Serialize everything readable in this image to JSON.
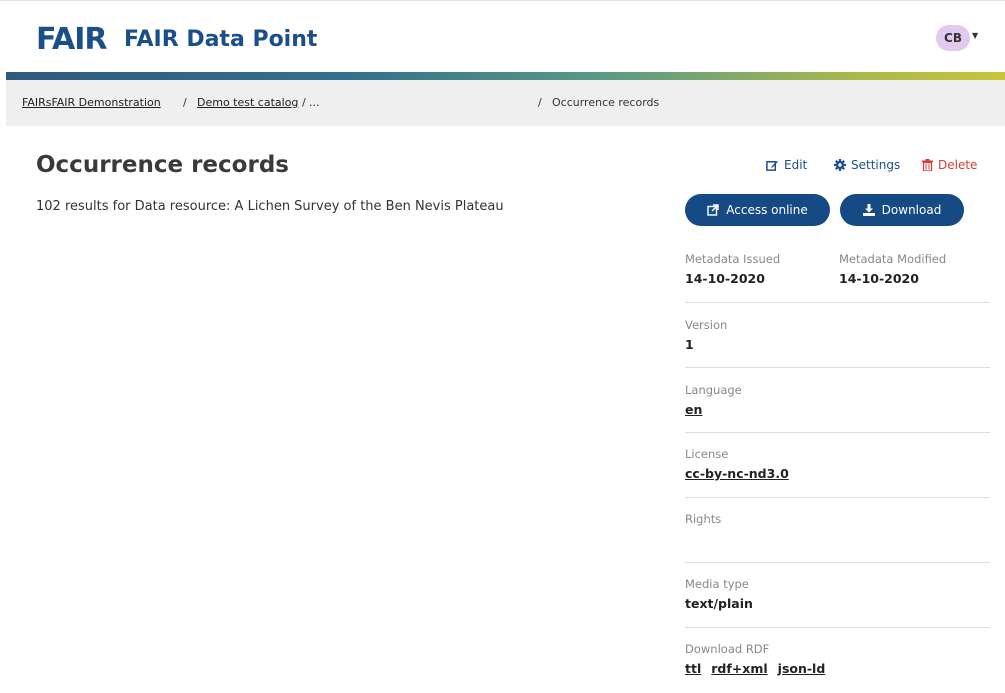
{
  "header": {
    "logo_text": "FAIR",
    "app_title": "FAIR Data Point",
    "user_initials": "CB",
    "accent_color": "#1a4f8b"
  },
  "breadcrumb": {
    "items": [
      "FAIRsFAIR Demonstration",
      "Demo test catalog",
      "..."
    ],
    "separator": "/",
    "current": "Occurrence records"
  },
  "main": {
    "title": "Occurrence records",
    "results_text": "102 results for Data resource: A Lichen Survey of the Ben Nevis Plateau"
  },
  "actions": {
    "edit_label": "Edit",
    "settings_label": "Settings",
    "delete_label": "Delete",
    "access_online_label": "Access online",
    "download_label": "Download"
  },
  "metadata": {
    "issued_label": "Metadata Issued",
    "issued_value": "14-10-2020",
    "modified_label": "Metadata Modified",
    "modified_value": "14-10-2020",
    "version_label": "Version",
    "version_value": "1",
    "language_label": "Language",
    "language_value": "en",
    "license_label": "License",
    "license_value": "cc-by-nc-nd3.0",
    "rights_label": "Rights",
    "media_type_label": "Media type",
    "media_type_value": "text/plain",
    "download_rdf_label": "Download RDF",
    "rdf_formats": [
      "ttl",
      "rdf+xml",
      "json-ld"
    ]
  },
  "icons": {
    "edit": "edit-icon",
    "settings": "gear-icon",
    "delete": "trash-icon",
    "access": "external-link-icon",
    "download": "download-icon"
  }
}
